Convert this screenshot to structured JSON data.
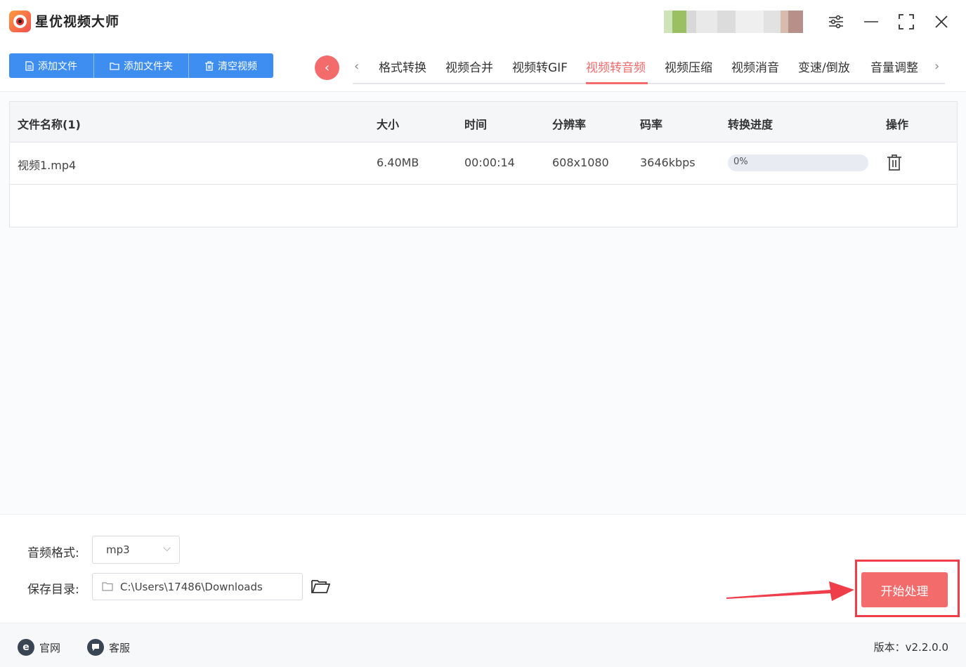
{
  "app": {
    "title": "星优视频大师"
  },
  "toolbar": {
    "add_file": "添加文件",
    "add_folder": "添加文件夹",
    "clear": "清空视频"
  },
  "tabs": [
    {
      "label": "格式转换"
    },
    {
      "label": "视频合并"
    },
    {
      "label": "视频转GIF"
    },
    {
      "label": "视频转音频",
      "active": true
    },
    {
      "label": "视频压缩"
    },
    {
      "label": "视频消音"
    },
    {
      "label": "变速/倒放"
    },
    {
      "label": "音量调整"
    }
  ],
  "table": {
    "headers": [
      "文件名称(1)",
      "大小",
      "时间",
      "分辨率",
      "码率",
      "转换进度",
      "操作"
    ],
    "rows": [
      {
        "name": "视频1.mp4",
        "size": "6.40MB",
        "time": "00:00:14",
        "resolution": "608x1080",
        "bitrate": "3646kbps",
        "progress_label": "0%",
        "progress": 0
      }
    ]
  },
  "settings": {
    "format_label": "音频格式:",
    "format_value": "mp3",
    "dir_label": "保存目录:",
    "dir_value": "C:\\Users\\17486\\Downloads"
  },
  "actions": {
    "start": "开始处理"
  },
  "footer": {
    "website": "官网",
    "support": "客服",
    "version": "版本：v2.2.0.0"
  },
  "colors": {
    "accent": "#f46b6b",
    "primary": "#3d8ef0",
    "annotation": "#ef3e4a"
  },
  "icons": {
    "logo": "camera-lens-icon",
    "settings": "sliders-icon",
    "minimize": "minimize-icon",
    "maximize": "maximize-icon",
    "close": "close-icon"
  }
}
